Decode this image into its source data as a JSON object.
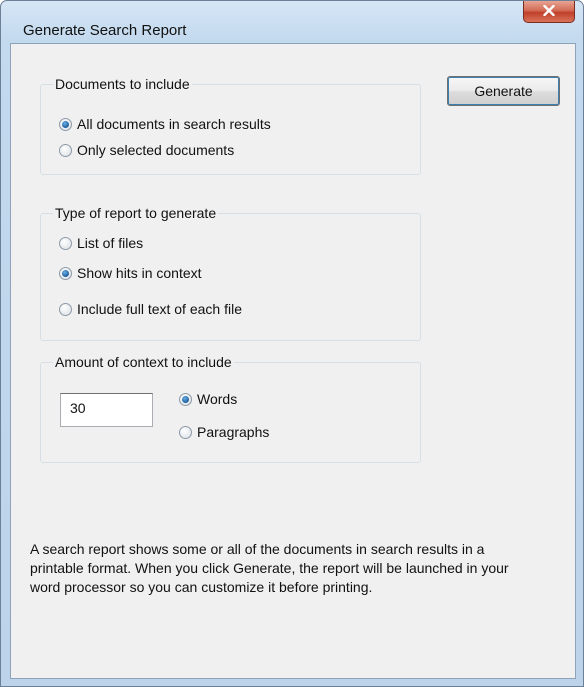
{
  "window": {
    "title": "Generate Search Report"
  },
  "documents_group": {
    "label": "Documents to include",
    "options": [
      {
        "label": "All documents in search results",
        "selected": true
      },
      {
        "label": "Only selected documents",
        "selected": false
      }
    ]
  },
  "report_type_group": {
    "label": "Type of report to generate",
    "options": [
      {
        "label": "List of files",
        "selected": false
      },
      {
        "label": "Show hits in context",
        "selected": true
      },
      {
        "label": "Include full text of each file",
        "selected": false
      }
    ]
  },
  "context_group": {
    "label": "Amount of context to include",
    "amount_value": "30",
    "options": [
      {
        "label": "Words",
        "selected": true
      },
      {
        "label": "Paragraphs",
        "selected": false
      }
    ]
  },
  "generate_button": {
    "label": "Generate"
  },
  "description": "A search report shows some or all of the documents in search results in a printable format.  When you click Generate, the report will be launched in your word processor so you can customize it before printing."
}
